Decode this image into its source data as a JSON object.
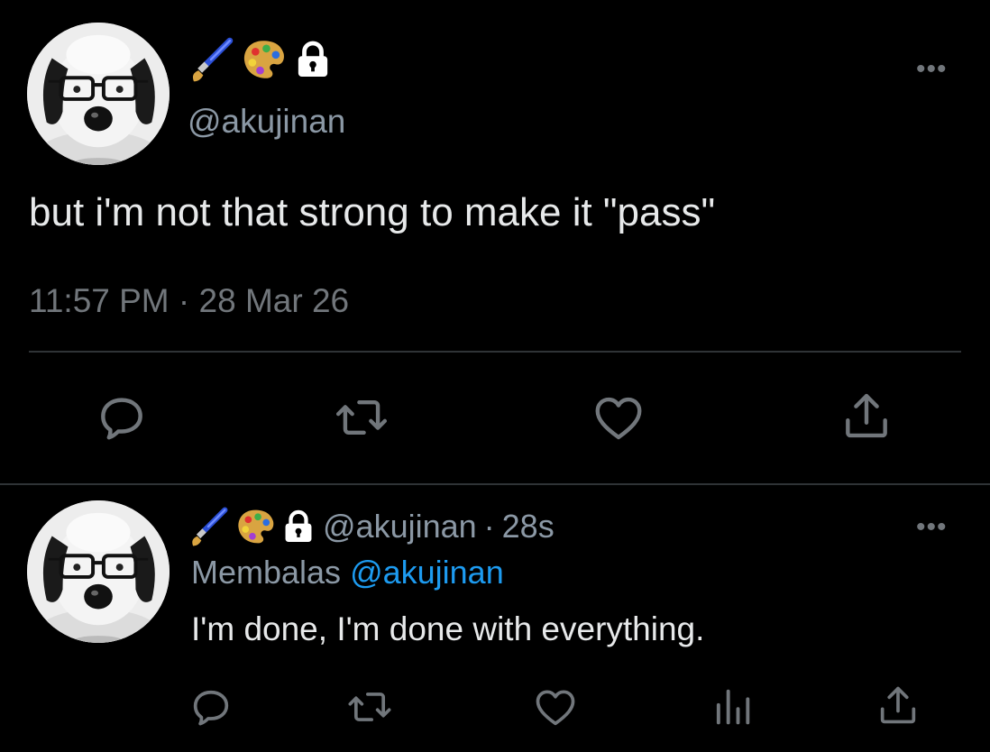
{
  "main_tweet": {
    "handle": "@akujinan",
    "text": "but i'm not that strong to make it \"pass\"",
    "time": "11:57 PM",
    "separator": "·",
    "date": "28 Mar 26",
    "name_icons": [
      "paintbrush-emoji",
      "palette-emoji",
      "lock-icon"
    ],
    "actions": [
      "reply-icon",
      "retweet-icon",
      "like-icon",
      "share-icon"
    ]
  },
  "reply_tweet": {
    "handle": "@akujinan",
    "separator": "·",
    "age": "28s",
    "replying_prefix": "Membalas",
    "replying_to": "@akujinan",
    "text": "I'm done, I'm done with everything.",
    "name_icons": [
      "paintbrush-emoji",
      "palette-emoji",
      "lock-icon"
    ],
    "actions": [
      "reply-icon",
      "retweet-icon",
      "like-icon",
      "analytics-icon",
      "share-icon"
    ]
  },
  "more_label": "•••",
  "colors": {
    "background": "#000000",
    "text": "#e7e9ea",
    "secondary": "#71767b",
    "link": "#1d9bf0",
    "divider": "#2f3336"
  }
}
